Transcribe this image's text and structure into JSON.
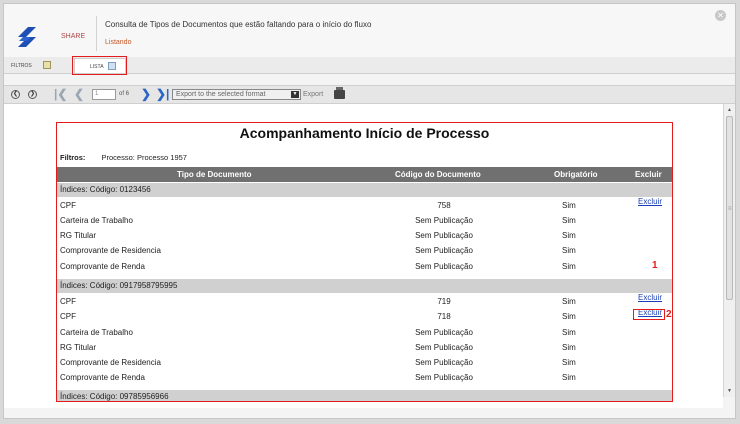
{
  "header": {
    "app_name": "SHARE",
    "title": "Consulta de Tipos de Documentos que estão faltando para o início do fluxo",
    "subtitle": "Listando",
    "close_symbol": "✕"
  },
  "tabs": [
    {
      "label": "FILTROS",
      "icon": "filter-icon"
    },
    {
      "label": "LISTA",
      "icon": "list-icon"
    }
  ],
  "toolbar": {
    "back_symbol": "❮",
    "forward_symbol": "❯",
    "first_symbol": "|❮",
    "prev_symbol": "❮",
    "next_symbol": "❯",
    "last_symbol": "❯|",
    "page_value": "1",
    "page_of": "of 6",
    "export_format": "Export to the selected format",
    "export_label": "Export"
  },
  "report": {
    "title": "Acompanhamento Início de Processo",
    "filtros_label": "Filtros:",
    "filtros_value": "Processo: Processo 1957",
    "columns": [
      "Tipo de Documento",
      "Código do Documento",
      "Obrigatório",
      "Excluir"
    ],
    "groups": [
      {
        "header": "Índices:  Código: 0123456",
        "rows": [
          {
            "tipo": "CPF",
            "codigo": "758",
            "obrigatorio": "Sim",
            "excluir": "Excluir"
          },
          {
            "tipo": "Carteira de Trabalho",
            "codigo": "Sem Publicação",
            "obrigatorio": "Sim",
            "excluir": ""
          },
          {
            "tipo": "RG Titular",
            "codigo": "Sem Publicação",
            "obrigatorio": "Sim",
            "excluir": ""
          },
          {
            "tipo": "Comprovante de Residencia",
            "codigo": "Sem Publicação",
            "obrigatorio": "Sim",
            "excluir": ""
          },
          {
            "tipo": "Comprovante de Renda",
            "codigo": "Sem Publicação",
            "obrigatorio": "Sim",
            "excluir": ""
          }
        ]
      },
      {
        "header": "Índices:  Código: 0917958795995",
        "rows": [
          {
            "tipo": "CPF",
            "codigo": "719",
            "obrigatorio": "Sim",
            "excluir": "Excluir"
          },
          {
            "tipo": "CPF",
            "codigo": "718",
            "obrigatorio": "Sim",
            "excluir": "Excluir"
          },
          {
            "tipo": "Carteira de Trabalho",
            "codigo": "Sem Publicação",
            "obrigatorio": "Sim",
            "excluir": ""
          },
          {
            "tipo": "RG Titular",
            "codigo": "Sem Publicação",
            "obrigatorio": "Sim",
            "excluir": ""
          },
          {
            "tipo": "Comprovante de Residencia",
            "codigo": "Sem Publicação",
            "obrigatorio": "Sim",
            "excluir": ""
          },
          {
            "tipo": "Comprovante de Renda",
            "codigo": "Sem Publicação",
            "obrigatorio": "Sim",
            "excluir": ""
          }
        ]
      },
      {
        "header": "Índices:  Código: 09785956966",
        "rows": []
      }
    ]
  },
  "annotations": {
    "marker_1": "1",
    "marker_2": "2"
  },
  "colors": {
    "highlight": "#e21c1c",
    "link": "#1a3fb8",
    "table_header": "#707070",
    "group_header": "#d0d0d0"
  }
}
